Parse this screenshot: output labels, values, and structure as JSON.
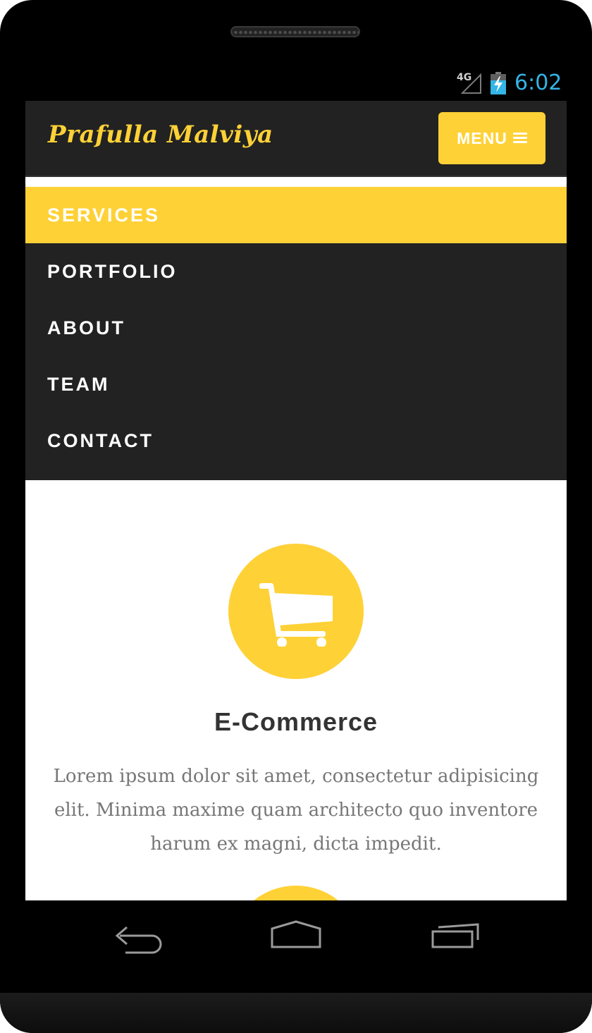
{
  "status_bar": {
    "network": "4G",
    "time": "6:02",
    "clock_color": "#33b5e5",
    "icons": [
      "signal-icon",
      "battery-charging-icon"
    ]
  },
  "header": {
    "brand": "Prafulla Malviya",
    "menu_label": "MENU",
    "menu_icon": "hamburger-icon",
    "accent_color": "#fed136"
  },
  "nav": {
    "items": [
      {
        "label": "SERVICES",
        "active": true
      },
      {
        "label": "PORTFOLIO",
        "active": false
      },
      {
        "label": "ABOUT",
        "active": false
      },
      {
        "label": "TEAM",
        "active": false
      },
      {
        "label": "CONTACT",
        "active": false
      }
    ]
  },
  "services": {
    "items": [
      {
        "icon": "shopping-cart-icon",
        "title": "E-Commerce",
        "text": "Lorem ipsum dolor sit amet, consectetur adipisicing elit. Minima maxime quam architecto quo inventore harum ex magni, dicta impedit."
      }
    ]
  },
  "system_nav": {
    "buttons": [
      "back-icon",
      "home-icon",
      "recent-apps-icon"
    ]
  }
}
